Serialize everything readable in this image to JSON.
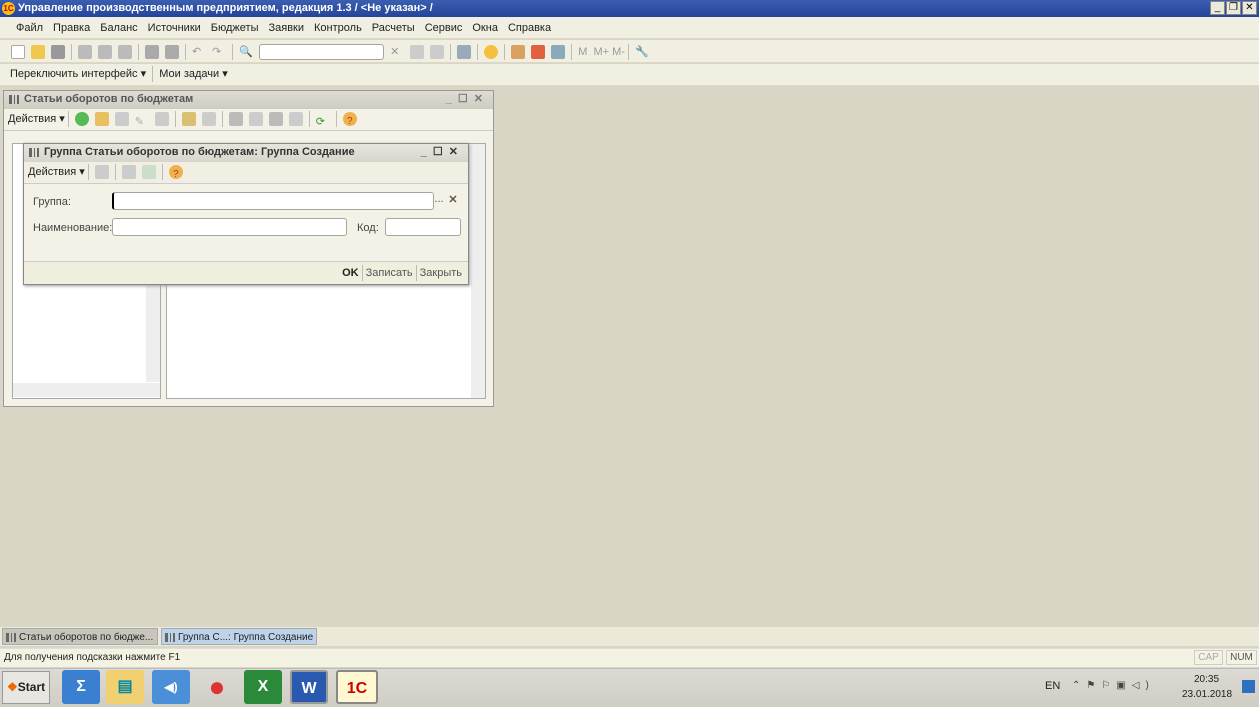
{
  "app": {
    "title": "Управление производственным предприятием, редакция 1.3 / <Не указан> /",
    "logo": "1С"
  },
  "menu": [
    "Файл",
    "Правка",
    "Баланс",
    "Источники",
    "Бюджеты",
    "Заявки",
    "Контроль",
    "Расчеты",
    "Сервис",
    "Окна",
    "Справка"
  ],
  "toolbar": {
    "memory": [
      "M",
      "M+",
      "M-"
    ],
    "search_value": ""
  },
  "toolbar2": {
    "switch_interface": "Переключить интерфейс",
    "my_tasks": "Мои задачи"
  },
  "list_window": {
    "title": "Статьи оборотов по бюджетам",
    "actions": "Действия"
  },
  "dialog": {
    "title": "Группа Статьи оборотов по бюджетам: Группа Создание",
    "actions": "Действия",
    "group_label": "Группа:",
    "group_value": "",
    "choose": "...",
    "clear": "✕",
    "name_label": "Наименование:",
    "name_value": "",
    "code_label": "Код:",
    "code_value": "",
    "ok": "OK",
    "save": "Записать",
    "close": "Закрыть"
  },
  "window_tabs": [
    "Статьи оборотов по бюдже...",
    "Группа С...: Группа Создание"
  ],
  "status": {
    "hint": "Для получения подсказки нажмите F1",
    "cap": "CAP",
    "num": "NUM"
  },
  "taskbar": {
    "start": "Start",
    "lang": "EN",
    "time": "20:35",
    "date": "23.01.2018",
    "apps": [
      "Σ",
      "▤",
      "◀)",
      "●",
      "X",
      "W",
      "1С"
    ]
  }
}
